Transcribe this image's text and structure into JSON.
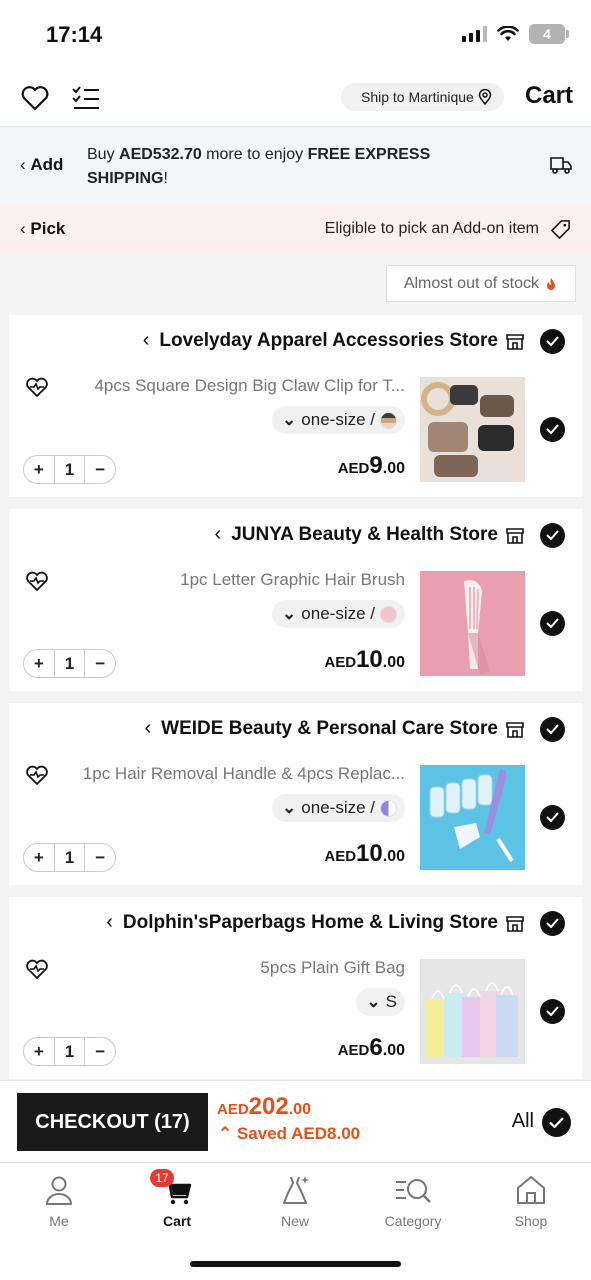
{
  "status_bar": {
    "time": "17:14",
    "battery": "4"
  },
  "header": {
    "ship_to": "Ship to Martinique",
    "title": "Cart"
  },
  "shipping_banner": {
    "add_label": "Add",
    "text_prefix": "Buy ",
    "amount": "AED532.70",
    "text_middle": " more to enjoy ",
    "highlight": "FREE EXPRESS SHIPPING",
    "text_suffix": "!"
  },
  "pick_banner": {
    "label": "Pick",
    "text": "Eligible to pick an Add-on item"
  },
  "stock_filter": {
    "label": "Almost out of stock"
  },
  "stores": [
    {
      "name": "Lovelyday Apparel Accessories Store",
      "item": {
        "title": "4pcs Square Design Big Claw Clip for T...",
        "variant": "one-size /",
        "swatch": "#8a6f5a",
        "quantity": "1",
        "currency": "AED",
        "price_int": "9",
        "price_dec": ".00"
      }
    },
    {
      "name": "JUNYA Beauty & Health Store",
      "item": {
        "title": "1pc Letter Graphic Hair Brush",
        "variant": "one-size /",
        "swatch": "#f3c3cc",
        "quantity": "1",
        "currency": "AED",
        "price_int": "10",
        "price_dec": ".00"
      }
    },
    {
      "name": "WEIDE Beauty & Personal Care Store",
      "item": {
        "title": "1pc Hair Removal Handle & 4pcs Replac...",
        "variant": "one-size /",
        "swatch": "#8d86e0",
        "quantity": "1",
        "currency": "AED",
        "price_int": "10",
        "price_dec": ".00"
      }
    },
    {
      "name": "Dolphin'sPaperbags Home & Living Store",
      "item": {
        "title": "5pcs Plain Gift Bag",
        "variant": "S",
        "swatch": "",
        "quantity": "1",
        "currency": "AED",
        "price_int": "6",
        "price_dec": ".00"
      }
    }
  ],
  "checkout": {
    "button_label": "CHECKOUT (17)",
    "currency": "AED",
    "total_int": "202",
    "total_dec": ".00",
    "saved": "Saved AED8.00",
    "all_label": "All"
  },
  "tabbar": {
    "items": [
      {
        "label": "Me",
        "icon": "person-icon"
      },
      {
        "label": "Cart",
        "icon": "cart-icon",
        "badge": "17"
      },
      {
        "label": "New",
        "icon": "dress-icon"
      },
      {
        "label": "Category",
        "icon": "category-search-icon"
      },
      {
        "label": "Shop",
        "icon": "home-icon"
      }
    ]
  },
  "colors": {
    "accent": "#e8501a",
    "dark": "#111111",
    "badge": "#e53935",
    "banner_green": "#eff8f7",
    "banner_pink": "#fdf1ee"
  }
}
